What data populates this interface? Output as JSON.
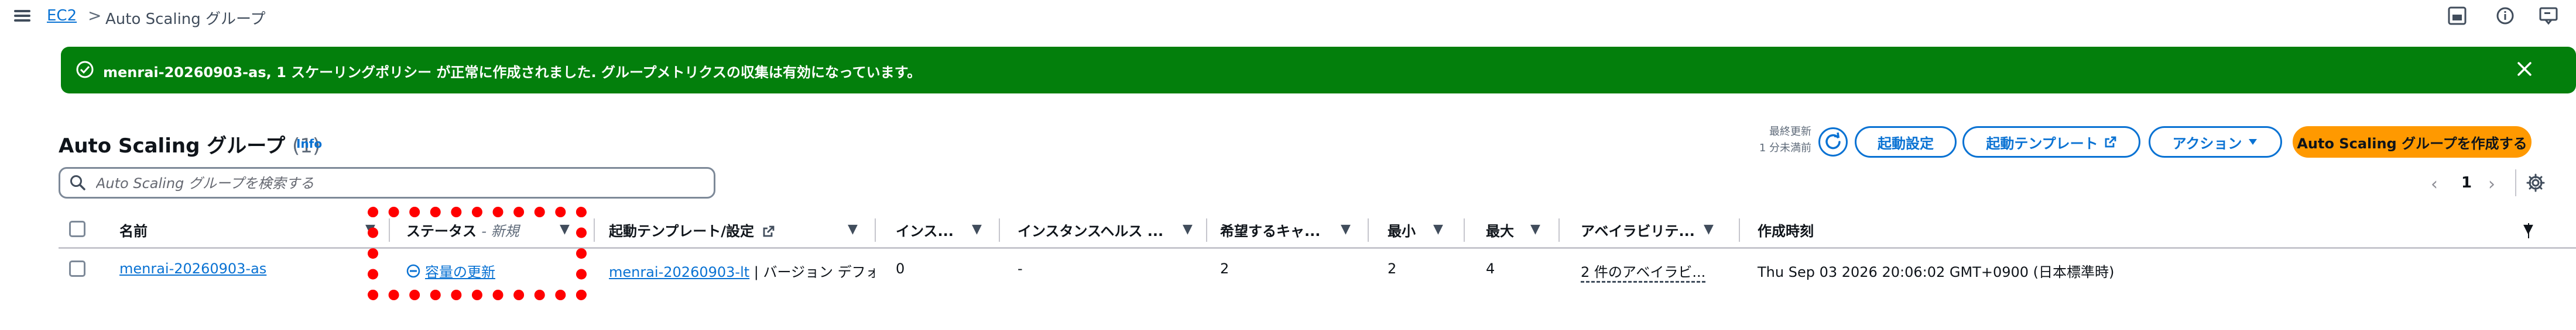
{
  "breadcrumb": {
    "root": "EC2",
    "separator": ">",
    "current": "Auto Scaling グループ"
  },
  "flash": {
    "message": "menrai-20260903-as, 1 スケーリングポリシー が正常に作成されました. グループメトリクスの収集は有効になっています。"
  },
  "header": {
    "title": "Auto Scaling グループ",
    "count": "(1)",
    "info": "Info",
    "last_updated_line1": "最終更新",
    "last_updated_line2": "1 分未満前",
    "buttons": {
      "launch_config": "起動設定",
      "launch_template": "起動テンプレート",
      "actions": "アクション",
      "create": "Auto Scaling グループを作成する"
    }
  },
  "search": {
    "placeholder": "Auto Scaling グループを検索する",
    "value": ""
  },
  "pagination": {
    "prev": "‹",
    "page": "1",
    "next": "›"
  },
  "table": {
    "columns": {
      "name": "名前",
      "status": "ステータス",
      "status_sub": "- 新規",
      "launch_template": "起動テンプレート/設定",
      "instances": "インス...",
      "instance_health": "インスタンスヘルス ...",
      "desired": "希望するキャ...",
      "min": "最小",
      "max": "最大",
      "az": "アベイラビリテ...",
      "created": "作成時刻"
    },
    "rows": [
      {
        "name": "menrai-20260903-as",
        "status": "容量の更新",
        "launch_template_link": "menrai-20260903-lt",
        "launch_template_rest": " | バージョン デフォル",
        "instances": "0",
        "instance_health": "-",
        "desired": "2",
        "min": "2",
        "max": "4",
        "az": "2 件のアベイラビ...",
        "created": "Thu Sep 03 2026 20:06:02 GMT+0900 (日本標準時)"
      }
    ]
  },
  "colors": {
    "primary_link": "#0972d3",
    "success": "#037f0c",
    "primary_button": "#ff9900",
    "annotation": "#ff0000"
  },
  "icons": {
    "menu": "hamburger-icon",
    "flash": "success-check-icon",
    "status": "in-progress-icon"
  }
}
